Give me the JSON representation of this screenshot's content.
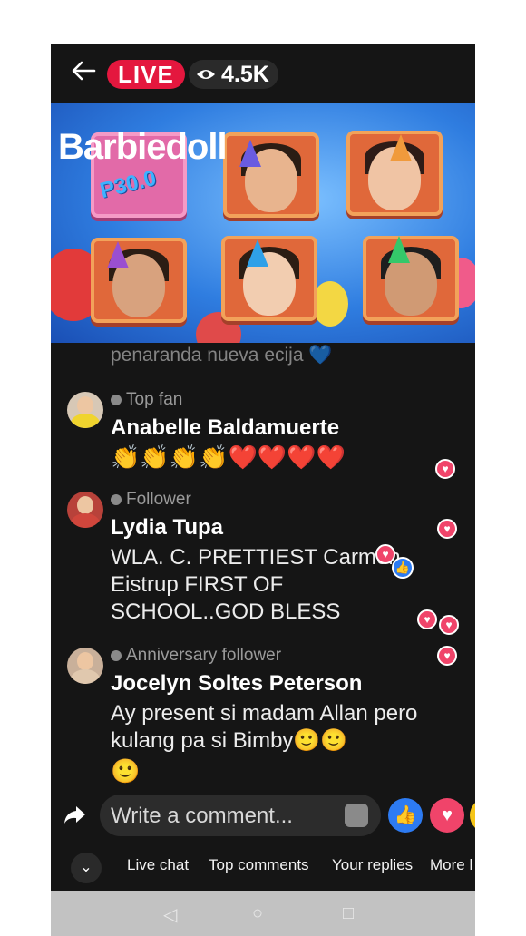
{
  "header": {
    "live_label": "LIVE",
    "viewer_count": "4.5K"
  },
  "video": {
    "overlay_title": "Barbiedoll",
    "price_tag": "P30.0"
  },
  "chat": {
    "partial_text": "penaranda nueva ecija 💙",
    "comments": [
      {
        "badge": "Top fan",
        "name": "Anabelle Baldamuerte",
        "text": "",
        "emojis": "👏👏👏👏❤️❤️❤️❤️"
      },
      {
        "badge": "Follower",
        "name": "Lydia Tupa",
        "text": "WLA. C. PRETTIEST Carmen Eistrup FIRST OF SCHOOL..GOD BLESS",
        "emojis": ""
      },
      {
        "badge": "Anniversary follower",
        "name": "Jocelyn Soltes Peterson",
        "text": "Ay present si madam Allan pero kulang pa si Bimby🙂🙂",
        "emojis": "🙂"
      }
    ]
  },
  "composer": {
    "placeholder": "Write a comment..."
  },
  "tabs": [
    "Live chat",
    "Top comments",
    "Your replies",
    "More l"
  ],
  "icons": {
    "back": "back-arrow-icon",
    "eye": "eye-icon",
    "share": "share-icon",
    "sticker": "sticker-icon",
    "like": "like-icon",
    "love": "heart-icon",
    "collapse": "chevron-down-icon"
  },
  "colors": {
    "live_red": "#e4173e",
    "like_blue": "#2d7bf2",
    "heart_pink": "#f0446a"
  }
}
